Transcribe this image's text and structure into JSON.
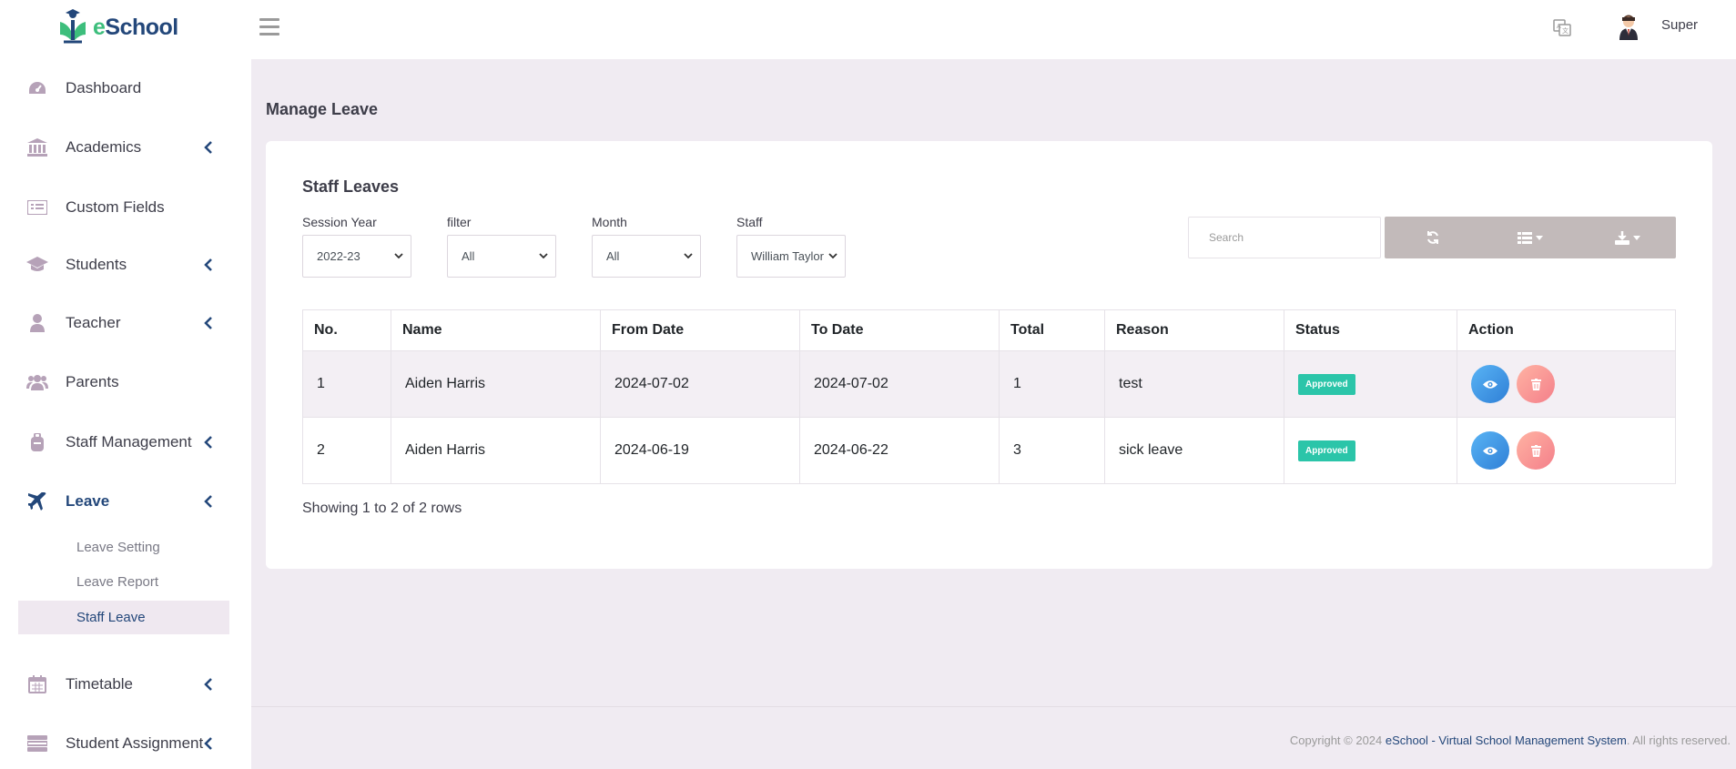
{
  "app": {
    "logo_text_e": "e",
    "logo_text_rest": "School",
    "user_name": "Super"
  },
  "sidebar": {
    "items": [
      {
        "label": "Dashboard",
        "icon": "dashboard-icon",
        "has_submenu": false
      },
      {
        "label": "Academics",
        "icon": "institution-icon",
        "has_submenu": true
      },
      {
        "label": "Custom Fields",
        "icon": "list-icon",
        "has_submenu": false
      },
      {
        "label": "Students",
        "icon": "graduation-cap-icon",
        "has_submenu": true
      },
      {
        "label": "Teacher",
        "icon": "user-icon",
        "has_submenu": true
      },
      {
        "label": "Parents",
        "icon": "users-icon",
        "has_submenu": false
      },
      {
        "label": "Staff Management",
        "icon": "staff-icon",
        "has_submenu": true
      },
      {
        "label": "Leave",
        "icon": "plane-icon",
        "has_submenu": true,
        "active": true
      },
      {
        "label": "Timetable",
        "icon": "calendar-icon",
        "has_submenu": true
      },
      {
        "label": "Student Assignment",
        "icon": "assignment-icon",
        "has_submenu": true
      }
    ],
    "leave_submenu": [
      {
        "label": "Leave Setting"
      },
      {
        "label": "Leave Report"
      },
      {
        "label": "Staff Leave",
        "active": true
      }
    ]
  },
  "main": {
    "page_title": "Manage Leave",
    "card_title": "Staff Leaves",
    "filters": [
      {
        "label": "Session Year",
        "value": "2022-23"
      },
      {
        "label": "filter",
        "value": "All"
      },
      {
        "label": "Month",
        "value": "All"
      },
      {
        "label": "Staff",
        "value": "William Taylor"
      }
    ],
    "search_placeholder": "Search",
    "table": {
      "columns": [
        "No.",
        "Name",
        "From Date",
        "To Date",
        "Total",
        "Reason",
        "Status",
        "Action"
      ],
      "rows": [
        {
          "no": "1",
          "name": "Aiden Harris",
          "from": "2024-07-02",
          "to": "2024-07-02",
          "total": "1",
          "reason": "test",
          "status": "Approved"
        },
        {
          "no": "2",
          "name": "Aiden Harris",
          "from": "2024-06-19",
          "to": "2024-06-22",
          "total": "3",
          "reason": "sick leave",
          "status": "Approved"
        }
      ]
    },
    "showing_text": "Showing 1 to 2 of 2 rows"
  },
  "footer": {
    "prefix": "Copyright © 2024 ",
    "brand": "eSchool - Virtual School Management System",
    "suffix": ". All rights reserved."
  },
  "colors": {
    "brand_navy": "#23477a",
    "brand_green": "#3dbe7c",
    "badge_green": "#2bc5a9",
    "page_bg": "#f0ebf2"
  }
}
